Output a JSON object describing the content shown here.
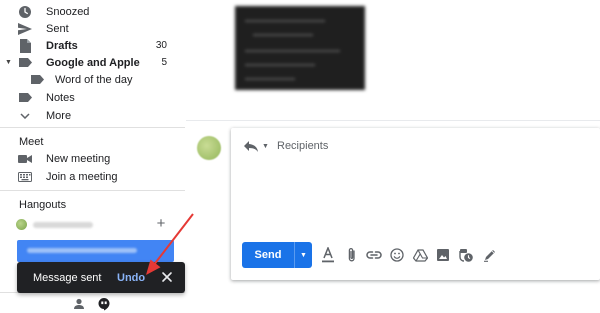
{
  "sidebar": {
    "items": [
      {
        "label": "Snoozed",
        "icon": "clock-icon"
      },
      {
        "label": "Sent",
        "icon": "send-icon"
      },
      {
        "label": "Drafts",
        "icon": "draft-icon",
        "count": "30"
      },
      {
        "label": "Google and Apple",
        "icon": "label-icon",
        "count": "5"
      },
      {
        "label": "Word of the day",
        "icon": "label-icon"
      },
      {
        "label": "Notes",
        "icon": "label-icon"
      },
      {
        "label": "More",
        "icon": "chevron-down-icon"
      }
    ],
    "meet": {
      "title": "Meet",
      "items": [
        {
          "label": "New meeting",
          "icon": "video-icon"
        },
        {
          "label": "Join a meeting",
          "icon": "keyboard-icon"
        }
      ]
    },
    "hangouts": {
      "title": "Hangouts"
    }
  },
  "snackbar": {
    "message": "Message sent",
    "undo_label": "Undo"
  },
  "compose": {
    "recipients_placeholder": "Recipients",
    "send_label": "Send",
    "toolbar_icons": [
      "format-text-icon",
      "attach-icon",
      "link-icon",
      "emoji-icon",
      "drive-icon",
      "photo-icon",
      "confidential-mode-icon",
      "signature-icon"
    ]
  },
  "colors": {
    "send_button": "#1a73e8",
    "snackbar_bg": "#202124",
    "undo_link": "#8ab4f8",
    "annotation_arrow": "#e53935"
  }
}
